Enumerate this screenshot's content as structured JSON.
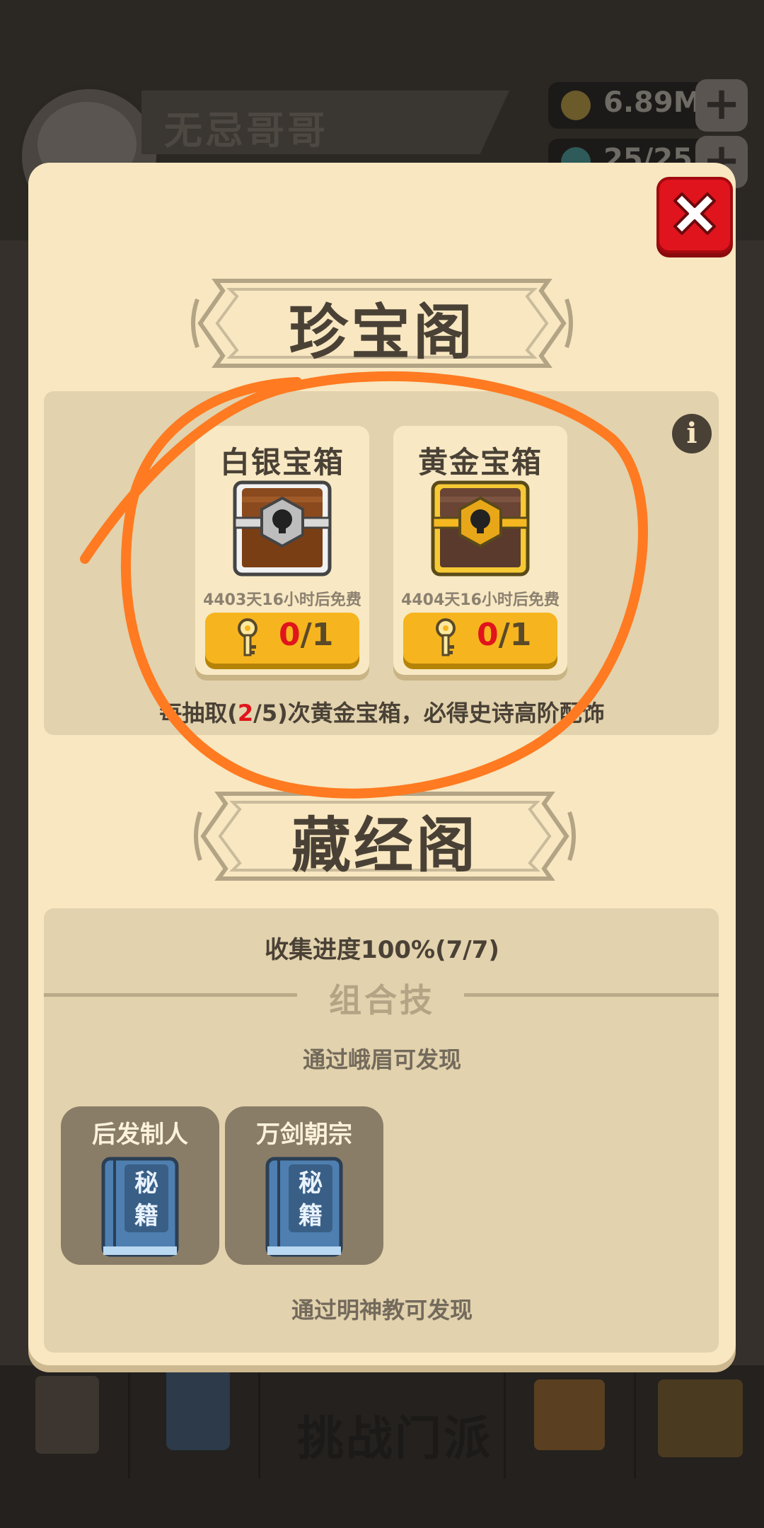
{
  "player": {
    "name": "无忌哥哥"
  },
  "currency": {
    "coins": "6.89M",
    "gems": "25/25"
  },
  "nav": {
    "challenge": "挑战门派"
  },
  "treasure": {
    "title": "珍宝阁",
    "chests": [
      {
        "name": "白银宝箱",
        "timer": "4403天16小时后免费",
        "owned": "0",
        "total": "/1",
        "color": "silver"
      },
      {
        "name": "黄金宝箱",
        "timer": "4404天16小时后免费",
        "owned": "0",
        "total": "/1",
        "color": "gold"
      }
    ],
    "pity": {
      "prefix": "每抽取(",
      "current": "2",
      "suffix": "/5)次黄金宝箱，必得史诗高阶配饰"
    }
  },
  "library": {
    "title": "藏经阁",
    "progress": "收集进度100%(7/7)",
    "combo_title": "组合技",
    "hint_emei": "通过峨眉可发现",
    "books": [
      {
        "name": "后发制人",
        "label_top": "秘",
        "label_bottom": "籍"
      },
      {
        "name": "万剑朝宗",
        "label_top": "秘",
        "label_bottom": "籍"
      }
    ],
    "hint_mingjiao": "通过明神教可发现"
  },
  "colors": {
    "accent_red": "#e0141c",
    "key_button": "#f6b51e",
    "panel_bg": "#f8e7c0",
    "annotation": "#ff7a21"
  }
}
